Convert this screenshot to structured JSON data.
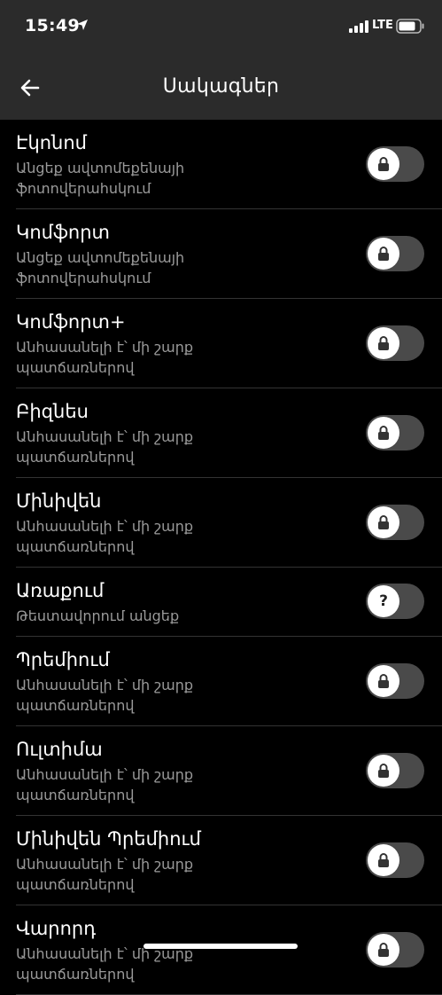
{
  "status": {
    "time": "15:49",
    "network": "LTE"
  },
  "header": {
    "title": "Սակագներ"
  },
  "tariffs": [
    {
      "name": "Էկոնոմ",
      "desc": "Անցեք ավտոմեքենայի ֆոտովերահսկում",
      "state": "locked"
    },
    {
      "name": "Կոմֆորտ",
      "desc": "Անցեք ավտոմեքենայի ֆոտովերահսկում",
      "state": "locked"
    },
    {
      "name": "Կոմֆորտ+",
      "desc": "Անհասանելի է՝ մի շարք պատճառներով",
      "state": "locked"
    },
    {
      "name": "Բիզնես",
      "desc": "Անհասանելի է՝ մի շարք պատճառներով",
      "state": "locked"
    },
    {
      "name": "Մինիվեն",
      "desc": "Անհասանելի է՝ մի շարք պատճառներով",
      "state": "locked"
    },
    {
      "name": "Առաքում",
      "desc": "Թեստավորում անցեք",
      "state": "unknown"
    },
    {
      "name": "Պրեմիում",
      "desc": "Անհասանելի է՝ մի շարք պատճառներով",
      "state": "locked"
    },
    {
      "name": "Ուլտիմա",
      "desc": "Անհասանելի է՝ մի շարք պատճառներով",
      "state": "locked"
    },
    {
      "name": "Մինիվեն Պրեմիում",
      "desc": "Անհասանելի է՝ մի շարք պատճառներով",
      "state": "locked"
    },
    {
      "name": "Վարորդ",
      "desc": "Անհասանելի է՝ մի շարք պատճառներով",
      "state": "locked"
    }
  ],
  "icons": {
    "locked": "lock-icon",
    "unknown": "question-icon"
  },
  "colors": {
    "background": "#000000",
    "header": "#2b2b2b",
    "toggle_track": "#4a4a4a",
    "secondary_text": "#9a9a9a"
  }
}
